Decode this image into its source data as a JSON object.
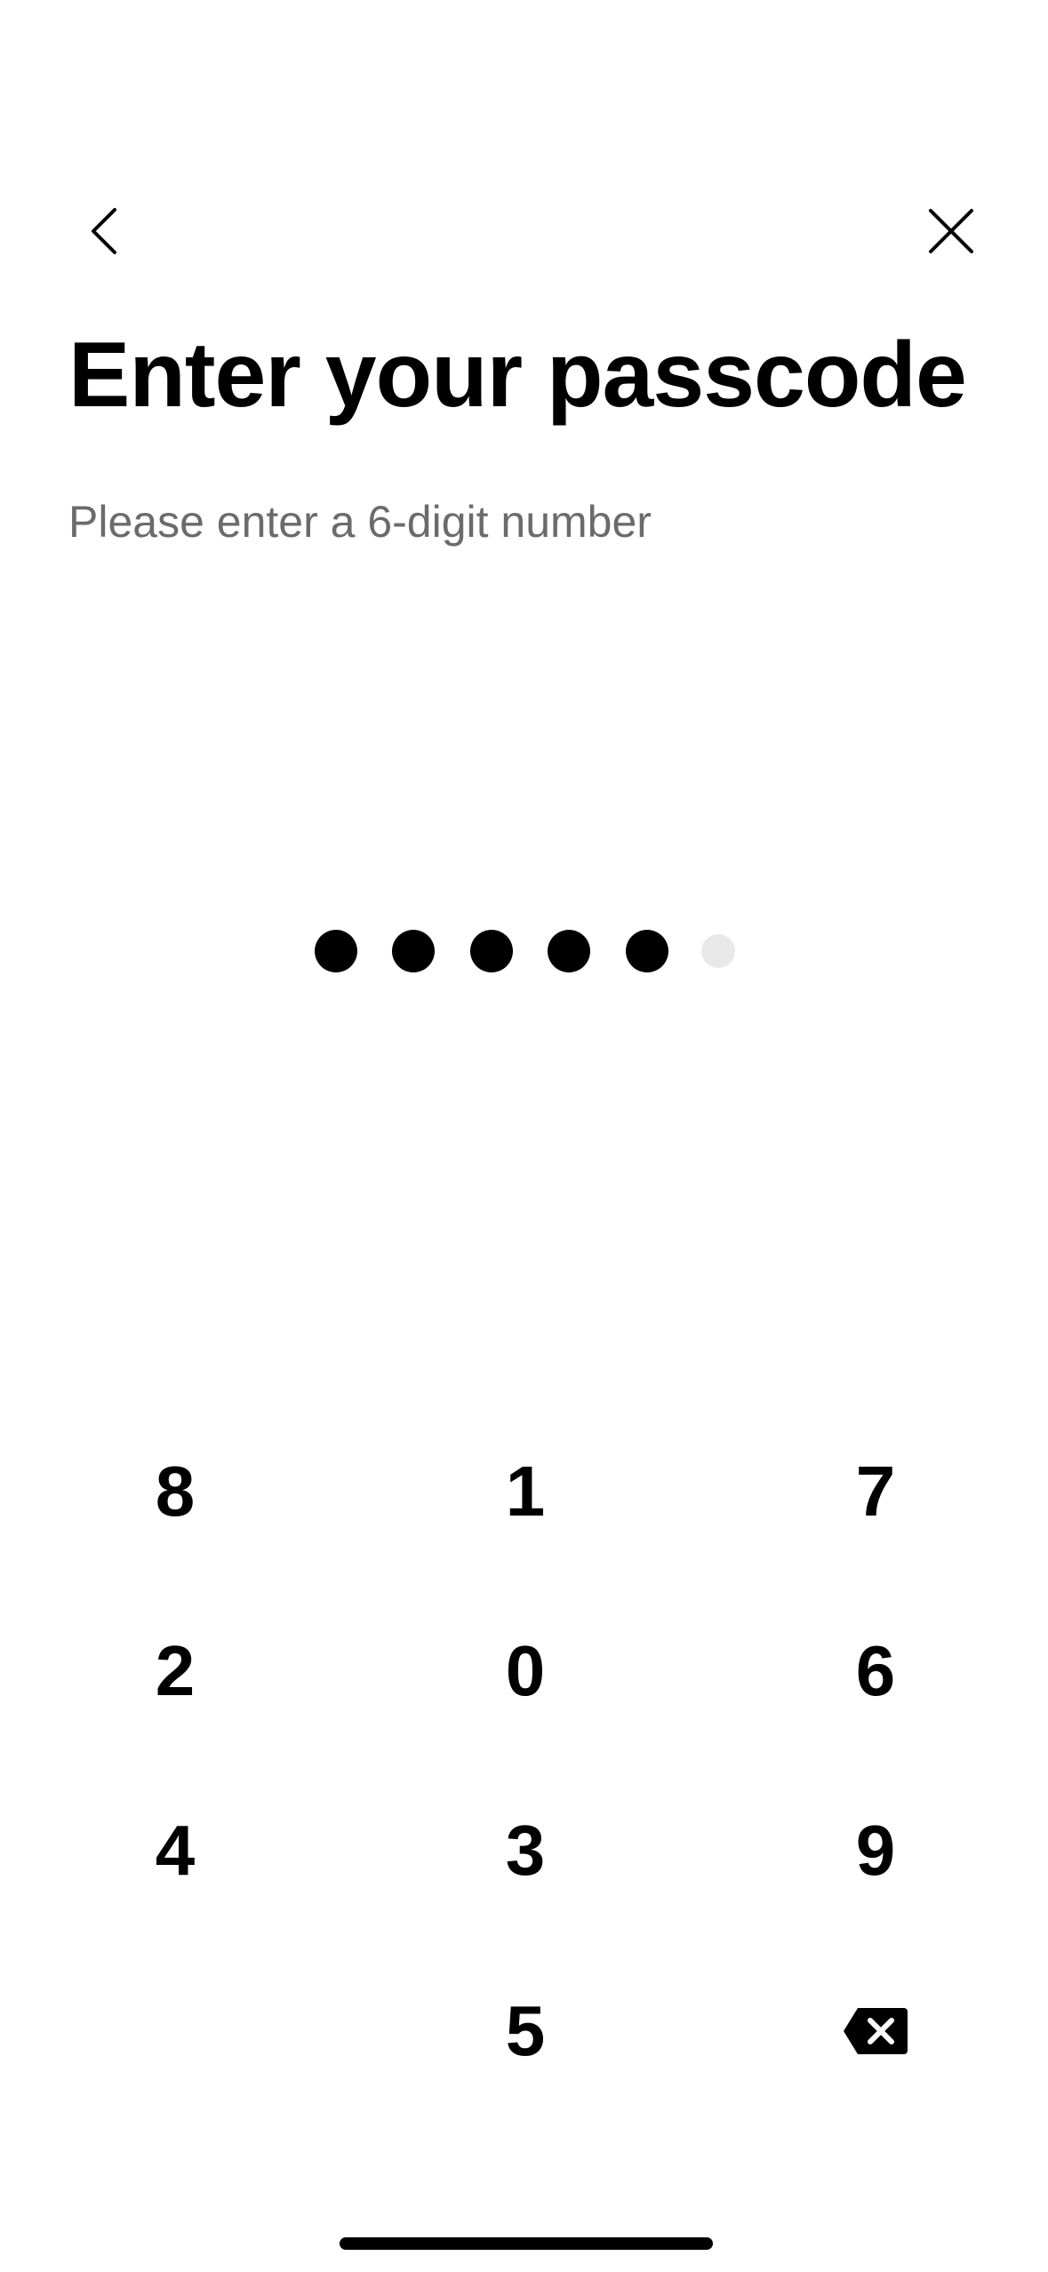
{
  "header": {
    "back_icon": "chevron-left-icon",
    "close_icon": "close-icon"
  },
  "title": "Enter your passcode",
  "subtitle": "Please enter a 6-digit number",
  "passcode": {
    "length": 6,
    "entered": 5
  },
  "keypad": {
    "rows": [
      [
        "8",
        "1",
        "7"
      ],
      [
        "2",
        "0",
        "6"
      ],
      [
        "4",
        "3",
        "9"
      ],
      [
        "",
        "5",
        "backspace"
      ]
    ],
    "backspace_icon": "backspace-icon"
  },
  "colors": {
    "text": "#000000",
    "subtitle": "#6b6b6b",
    "dot_filled": "#000000",
    "dot_empty": "#e8e8e8",
    "background": "#ffffff"
  }
}
